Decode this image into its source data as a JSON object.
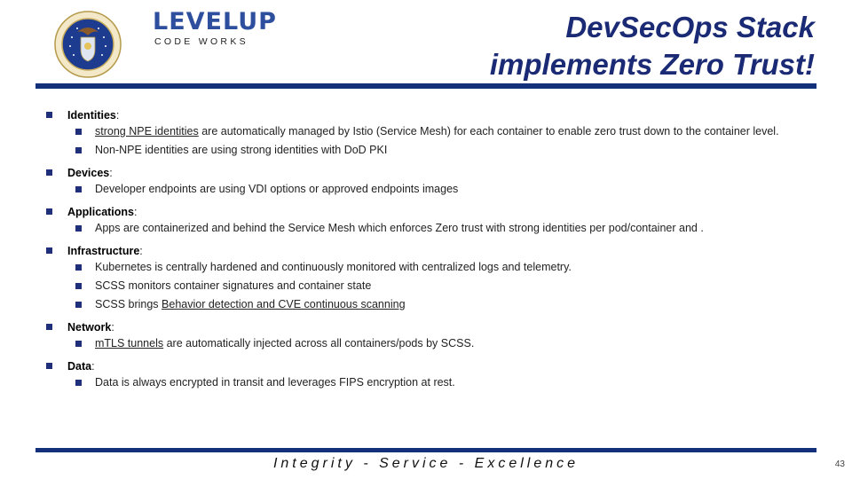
{
  "header": {
    "seal_label": "Department of the Air Force seal",
    "logo": {
      "wordmark": "LEVELUP",
      "subtitle": "CODE WORKS"
    },
    "title_line1": "DevSecOps Stack",
    "title_line2": "implements Zero Trust!"
  },
  "colors": {
    "accent_navy": "#13307a",
    "title_navy": "#1b2a74",
    "bullet": "#1f2f7a",
    "logo_blue": "#2d4f9e"
  },
  "sections": [
    {
      "heading": "Identities",
      "items": [
        {
          "underlined": "strong NPE identities",
          "text": " are automatically managed by Istio (Service Mesh) for each container to enable zero trust down to the container level."
        },
        {
          "underlined": "",
          "text": "Non-NPE identities are using strong identities with DoD PKI"
        }
      ]
    },
    {
      "heading": "Devices",
      "items": [
        {
          "underlined": "",
          "text": "Developer endpoints are using VDI options or approved endpoints images"
        }
      ]
    },
    {
      "heading": "Applications",
      "items": [
        {
          "underlined": "",
          "text": "Apps are containerized and behind the Service Mesh which enforces Zero trust with strong identities per pod/container and ."
        }
      ]
    },
    {
      "heading": "Infrastructure",
      "items": [
        {
          "underlined": "",
          "text": "Kubernetes is centrally hardened and continuously monitored with centralized logs and telemetry."
        },
        {
          "underlined": "",
          "text": "SCSS monitors container signatures and container state"
        },
        {
          "prefix": "SCSS brings ",
          "underlined": "Behavior detection and CVE continuous scanning",
          "text": ""
        }
      ]
    },
    {
      "heading": "Network",
      "items": [
        {
          "underlined": "mTLS tunnels",
          "text": " are automatically injected across all containers/pods by SCSS."
        }
      ]
    },
    {
      "heading": "Data",
      "items": [
        {
          "underlined": "",
          "text": "Data is always encrypted in transit and leverages FIPS encryption at rest."
        }
      ]
    }
  ],
  "footer": {
    "motto": "Integrity - Service - Excellence",
    "page_number": "43"
  }
}
